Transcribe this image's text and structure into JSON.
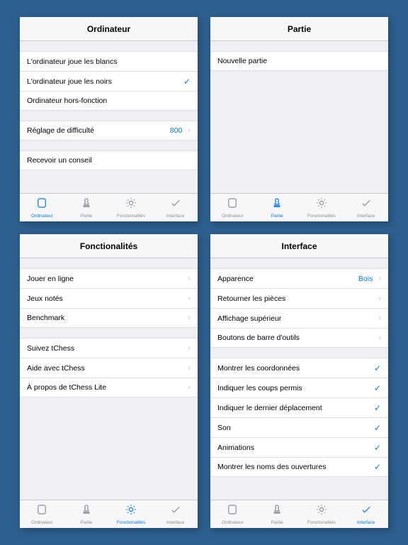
{
  "tabbar": {
    "items": [
      "Ordinateur",
      "Partie",
      "Fonctionalités",
      "Interface"
    ]
  },
  "panes": [
    {
      "title": "Ordinateur",
      "activeTab": 0,
      "groups": [
        [
          {
            "label": "L'ordinateur joue les blancs"
          },
          {
            "label": "L'ordinateur joue les noirs",
            "checked": true
          },
          {
            "label": "Ordinateur hors-fonction"
          }
        ],
        [
          {
            "label": "Réglage de difficulté",
            "value": "800",
            "chevron": true
          }
        ],
        [
          {
            "label": "Recevoir un conseil"
          }
        ]
      ]
    },
    {
      "title": "Partie",
      "activeTab": 1,
      "groups": [
        [
          {
            "label": "Nouvelle partie"
          }
        ]
      ]
    },
    {
      "title": "Fonctionalités",
      "activeTab": 2,
      "groups": [
        [
          {
            "label": "Jouer en ligne",
            "chevron": true
          },
          {
            "label": "Jeux notés",
            "chevron": true
          },
          {
            "label": "Benchmark",
            "chevron": true
          }
        ],
        [
          {
            "label": "Suivez tChess",
            "chevron": true
          },
          {
            "label": "Aide avec tChess",
            "chevron": true
          },
          {
            "label": "À propos de tChess Lite",
            "chevron": true
          }
        ]
      ]
    },
    {
      "title": "Interface",
      "activeTab": 3,
      "groups": [
        [
          {
            "label": "Apparence",
            "value": "Bois",
            "chevron": true
          },
          {
            "label": "Retourner les pièces",
            "chevron": true
          },
          {
            "label": "Affichage supérieur",
            "chevron": true
          },
          {
            "label": "Boutons de barre d'outils",
            "chevron": true
          }
        ],
        [
          {
            "label": "Montrer les coordonnées",
            "checked": true
          },
          {
            "label": "Indiquer les coups permis",
            "checked": true
          },
          {
            "label": "Indiquer le dernier déplacement",
            "checked": true
          },
          {
            "label": "Son",
            "checked": true
          },
          {
            "label": "Animations",
            "checked": true
          },
          {
            "label": "Montrer les noms des ouvertures",
            "checked": true
          }
        ]
      ]
    }
  ]
}
